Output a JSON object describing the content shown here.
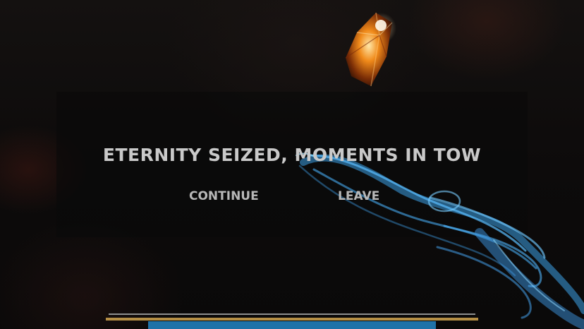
{
  "dialog": {
    "title": "ETERNITY SEIZED, MOMENTS IN TOW",
    "buttons": {
      "continue_label": "CONTINUE",
      "leave_label": "LEAVE"
    }
  },
  "hud": {
    "progress_bar_fill_fraction": 0.78,
    "colors": {
      "track": "#8e8f8f",
      "gold_trim": "#b58f45",
      "fill": "#1f72a8"
    }
  },
  "scene": {
    "gem_icon": "amber-crystal-icon",
    "hand_icon": "spectral-blue-hand-icon"
  }
}
